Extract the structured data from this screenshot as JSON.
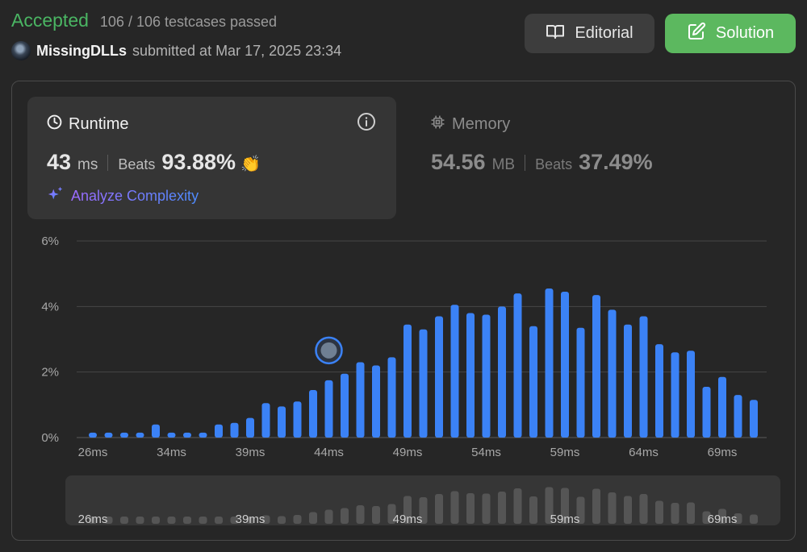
{
  "status": {
    "verdict": "Accepted",
    "testcases": "106 / 106 testcases passed"
  },
  "submission": {
    "username": "MissingDLLs",
    "submitted_text": "submitted at Mar 17, 2025 23:34"
  },
  "actions": {
    "editorial": "Editorial",
    "solution": "Solution"
  },
  "runtime": {
    "title": "Runtime",
    "value": "43",
    "unit": "ms",
    "beats_label": "Beats",
    "beats": "93.88%",
    "analyze": "Analyze Complexity"
  },
  "memory": {
    "title": "Memory",
    "value": "54.56",
    "unit": "MB",
    "beats_label": "Beats",
    "beats": "37.49%"
  },
  "colors": {
    "accepted": "#4ab563",
    "solution_button": "#5cb85f",
    "bar": "#3b82f6",
    "bar_selected": "#3b82f6",
    "overview_bar": "#555555"
  },
  "chart_data": {
    "type": "bar",
    "title": "",
    "xlabel": "",
    "ylabel": "",
    "ylim": [
      0,
      6
    ],
    "yticks": [
      "0%",
      "2%",
      "4%",
      "6%"
    ],
    "x_tick_labels": [
      "26ms",
      "34ms",
      "39ms",
      "44ms",
      "49ms",
      "54ms",
      "59ms",
      "64ms",
      "69ms"
    ],
    "x_tick_indices": [
      0,
      5,
      10,
      15,
      20,
      25,
      30,
      35,
      40
    ],
    "selected_index": 15,
    "values": [
      0.15,
      0.15,
      0.15,
      0.15,
      0.4,
      0.15,
      0.15,
      0.15,
      0.4,
      0.45,
      0.6,
      1.05,
      0.95,
      1.1,
      1.45,
      1.75,
      1.95,
      2.3,
      2.2,
      2.45,
      3.45,
      3.3,
      3.7,
      4.05,
      3.8,
      3.75,
      4.0,
      4.4,
      3.4,
      4.55,
      4.45,
      3.35,
      4.35,
      3.9,
      3.45,
      3.7,
      2.85,
      2.6,
      2.65,
      1.55,
      1.85,
      1.3,
      1.15
    ],
    "overview_tick_labels": [
      "26ms",
      "39ms",
      "49ms",
      "59ms",
      "69ms"
    ],
    "overview_tick_indices": [
      0,
      10,
      20,
      30,
      40
    ]
  }
}
